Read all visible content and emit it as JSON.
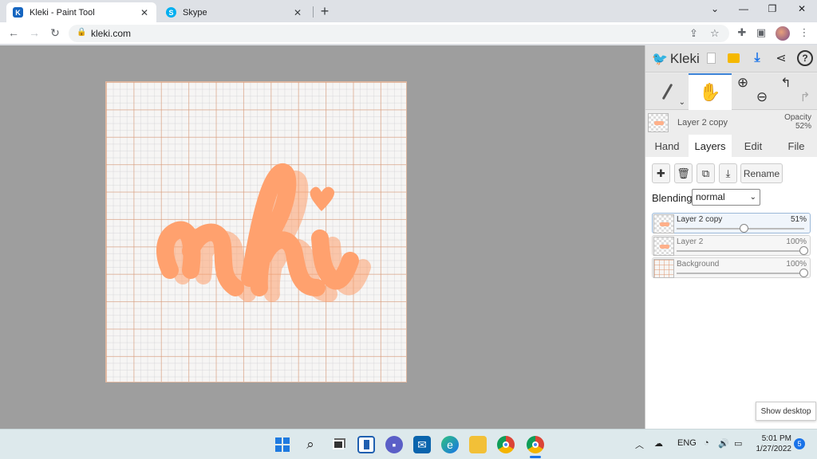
{
  "browser": {
    "tabs": [
      {
        "title": "Kleki - Paint Tool",
        "favicon_color": "#1565c0",
        "favicon_letter": "K"
      },
      {
        "title": "Skype",
        "favicon_color": "#00aff0",
        "favicon_letter": "S"
      }
    ],
    "url": "kleki.com",
    "new_tab": "+",
    "window": {
      "chevron": "⌄",
      "minimize": "—",
      "restore": "❐",
      "close": "✕"
    }
  },
  "kleki": {
    "logo": "Kleki",
    "tools": {
      "brush": "brush-icon",
      "hand": "hand-icon",
      "zoom_in": "⊕",
      "zoom_out": "⊖"
    },
    "current_layer": {
      "name": "Layer 2 copy",
      "opacity_label": "Opacity",
      "opacity_value": "52%"
    },
    "tabs": [
      "Hand",
      "Layers",
      "Edit",
      "File"
    ],
    "active_tab": "Layers",
    "rename_label": "Rename",
    "blending_label": "Blending",
    "blending_value": "normal",
    "layers": [
      {
        "name": "Layer 2 copy",
        "opacity": "51%",
        "level": 0.51
      },
      {
        "name": "Layer 2",
        "opacity": "100%",
        "level": 1.0
      },
      {
        "name": "Background",
        "opacity": "100%",
        "level": 1.0
      }
    ],
    "canvas_text": "nhi",
    "stroke_color": "#ffa16e"
  },
  "show_desktop": "Show desktop",
  "taskbar": {
    "lang": "ENG",
    "time": "5:01 PM",
    "date": "1/27/2022",
    "notification_count": "5"
  }
}
